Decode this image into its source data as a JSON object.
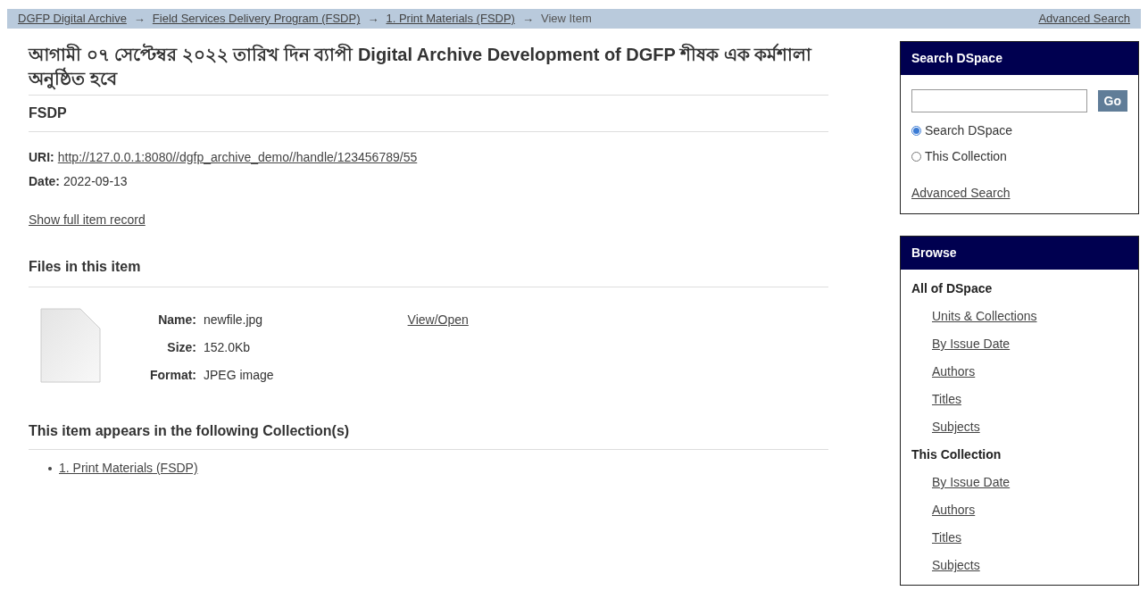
{
  "breadcrumb": {
    "items": [
      {
        "label": "DGFP Digital Archive",
        "kind": "link"
      },
      {
        "separator": "→",
        "label": "Field Services Delivery Program (FSDP)",
        "kind": "link"
      },
      {
        "separator": "→",
        "label": "1. Print Materials (FSDP)",
        "kind": "link"
      },
      {
        "separator": "→",
        "label": "View Item",
        "kind": "current"
      }
    ],
    "advanced_search": "Advanced Search"
  },
  "item": {
    "title": "আগামী ০৭ সেপ্টেম্বর ২০২২ তারিখ দিন ব্যাপী Digital Archive Development of DGFP শীষক এক কর্মশালা অনুষ্ঠিত হবে",
    "subtitle": "FSDP",
    "fields": [
      {
        "label": "URI:",
        "value": "http://127.0.0.1:8080//dgfp_archive_demo//handle/123456789/55",
        "kind": "link"
      },
      {
        "label": "Date:",
        "value": "2022-09-13",
        "kind": "text"
      }
    ],
    "full_record_link": "Show full item record"
  },
  "files": {
    "heading": "Files in this item",
    "file": {
      "details": [
        {
          "label": "Name:",
          "value": "newfile.jpg"
        },
        {
          "label": "Size:",
          "value": "152.0Kb"
        },
        {
          "label": "Format:",
          "value": "JPEG image"
        }
      ],
      "link": "View/Open"
    }
  },
  "collections": {
    "heading": "This item appears in the following Collection(s)",
    "items": [
      "1. Print Materials (FSDP)"
    ]
  },
  "search_box": {
    "title": "Search DSpace",
    "button": "Go",
    "scopes": [
      {
        "label": "Search DSpace",
        "selected": true
      },
      {
        "label": "This Collection",
        "selected": false
      }
    ],
    "advanced_search": "Advanced Search"
  },
  "browse": {
    "title": "Browse",
    "groups": [
      {
        "heading": "All of DSpace",
        "links": [
          "Units & Collections",
          "By Issue Date",
          "Authors",
          "Titles",
          "Subjects"
        ]
      },
      {
        "heading": "This Collection",
        "links": [
          "By Issue Date",
          "Authors",
          "Titles",
          "Subjects"
        ]
      }
    ]
  }
}
